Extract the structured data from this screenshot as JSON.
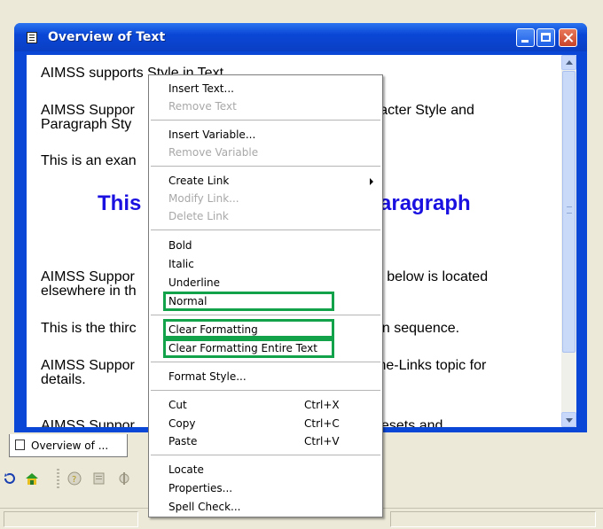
{
  "window": {
    "title": "Overview of Text"
  },
  "document": {
    "p1": "AIMSS supports Style in Text",
    "p2a": "AIMSS Suppor",
    "p2b": "aracter Style and",
    "p2c": "Paragraph Sty",
    "p3": "This is an exan",
    "heading_left": "This",
    "heading_right": "Paragraph",
    "p4a": "AIMSS Suppor",
    "p4b": "ph below is located",
    "p4c": "elsewhere in th",
    "p5a": "This is the thirc",
    "p5b": "tion sequence.",
    "p6a": "AIMSS Suppor",
    "p6b": "Line-Links topic for",
    "p6c": "details.",
    "p7a": "AIMSS Suppor",
    "p7b": "Presets and"
  },
  "doc_tab": {
    "label": "Overview of ..."
  },
  "context_menu": {
    "insert_text": "Insert Text...",
    "remove_text": "Remove Text",
    "insert_variable": "Insert Variable...",
    "remove_variable": "Remove Variable",
    "create_link": "Create Link",
    "modify_link": "Modify Link...",
    "delete_link": "Delete Link",
    "bold": "Bold",
    "italic": "Italic",
    "underline": "Underline",
    "normal": "Normal",
    "clear_formatting": "Clear Formatting",
    "clear_formatting_entire": "Clear Formatting Entire Text",
    "format_style": "Format Style...",
    "cut": "Cut",
    "cut_shortcut": "Ctrl+X",
    "copy": "Copy",
    "copy_shortcut": "Ctrl+C",
    "paste": "Paste",
    "paste_shortcut": "Ctrl+V",
    "locate": "Locate",
    "properties": "Properties...",
    "spell_check": "Spell Check..."
  },
  "colors": {
    "window_blue": "#0a47d6",
    "heading_blue": "#1a10e0",
    "highlight_green": "#12a24a",
    "disabled_text": "#a8a8a8"
  },
  "icons": [
    "document-icon",
    "minimize-icon",
    "maximize-icon",
    "close-icon",
    "home-icon",
    "refresh-icon",
    "help-icon"
  ]
}
